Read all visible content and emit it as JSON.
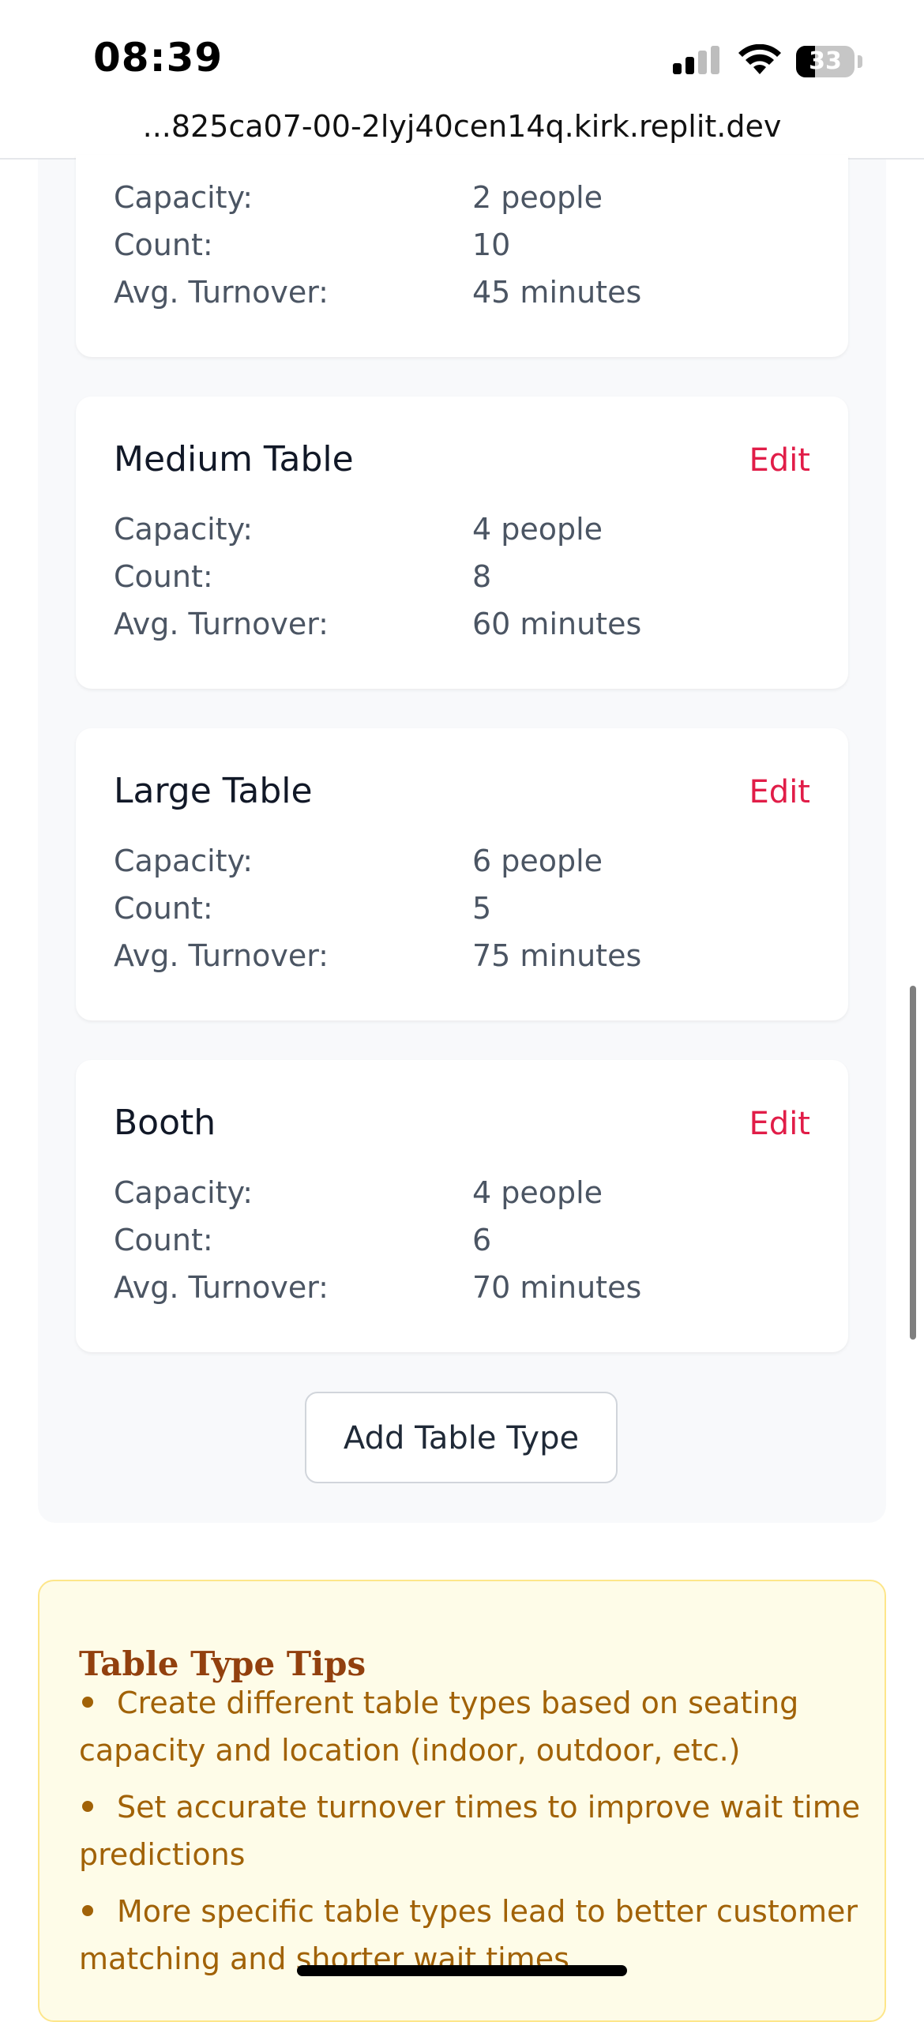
{
  "status_bar": {
    "time": "08:39",
    "battery": "33",
    "url": "...825ca07-00-2lyj40cen14q.kirk.replit.dev"
  },
  "partial_card": {
    "rows": [
      {
        "label": "Capacity:",
        "value": "2 people"
      },
      {
        "label": "Count:",
        "value": "10"
      },
      {
        "label": "Avg. Turnover:",
        "value": "45 minutes"
      }
    ]
  },
  "cards": [
    {
      "title": "Medium Table",
      "edit_label": "Edit",
      "rows": [
        {
          "label": "Capacity:",
          "value": "4 people"
        },
        {
          "label": "Count:",
          "value": "8"
        },
        {
          "label": "Avg. Turnover:",
          "value": "60 minutes"
        }
      ]
    },
    {
      "title": "Large Table",
      "edit_label": "Edit",
      "rows": [
        {
          "label": "Capacity:",
          "value": "6 people"
        },
        {
          "label": "Count:",
          "value": "5"
        },
        {
          "label": "Avg. Turnover:",
          "value": "75 minutes"
        }
      ]
    },
    {
      "title": "Booth",
      "edit_label": "Edit",
      "rows": [
        {
          "label": "Capacity:",
          "value": "4 people"
        },
        {
          "label": "Count:",
          "value": "6"
        },
        {
          "label": "Avg. Turnover:",
          "value": "70 minutes"
        }
      ]
    }
  ],
  "add_button_label": "Add Table Type",
  "tips": {
    "title": "Table Type Tips",
    "items": [
      {
        "text": "Create different table types based on seating capacity and location (indoor, outdoor, etc.)"
      },
      {
        "text": "Set accurate turnover times to improve wait time predictions"
      },
      {
        "text": "More specific table types lead to better customer matching and shorter wait times"
      }
    ]
  },
  "colors": {
    "edit": "#e11d48",
    "tips_background": "#fefce8",
    "tips_border": "#fde68a",
    "tips_text": "#a16207"
  }
}
